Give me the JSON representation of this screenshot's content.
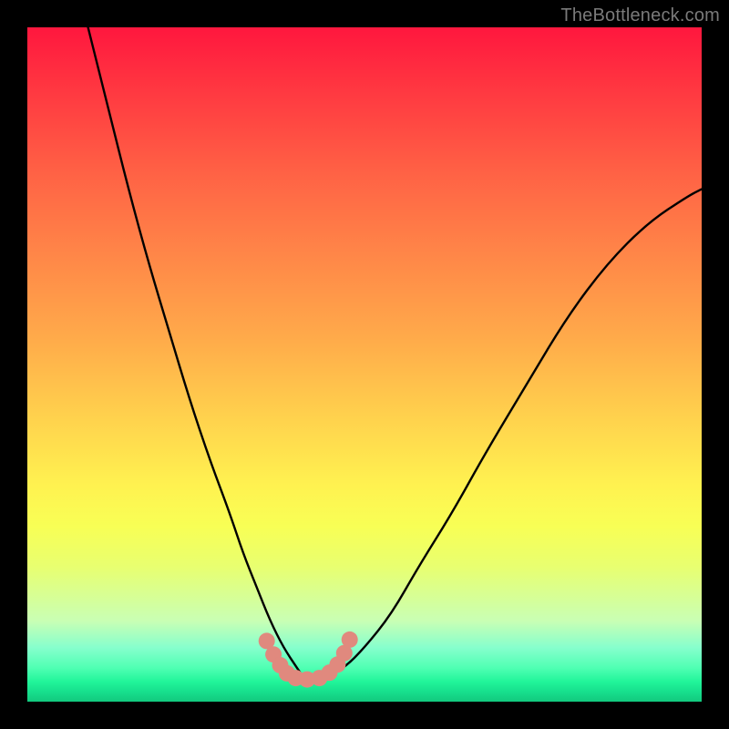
{
  "watermark": "TheBottleneck.com",
  "chart_data": {
    "type": "line",
    "title": "",
    "xlabel": "",
    "ylabel": "",
    "xlim": [
      0,
      100
    ],
    "ylim": [
      0,
      100
    ],
    "note": "Axes have no visible tick labels; values are normalized 0–100 on each axis. y=0 is the bottom (green) edge. Main black curve is a V-shape; salmon dotted curve highlights the trough.",
    "series": [
      {
        "name": "main-curve",
        "color": "#000000",
        "style": "solid",
        "x": [
          9,
          12,
          15,
          18,
          21,
          24,
          27,
          30,
          32,
          34,
          36,
          38,
          40,
          41,
          42,
          44,
          47,
          50,
          54,
          58,
          63,
          68,
          74,
          80,
          86,
          92,
          98,
          100
        ],
        "y": [
          100,
          88,
          76,
          65,
          55,
          45,
          36,
          28,
          22,
          17,
          12,
          8,
          5,
          3.5,
          3.3,
          3.5,
          5,
          8,
          13,
          20,
          28,
          37,
          47,
          57,
          65,
          71,
          75,
          76
        ]
      },
      {
        "name": "trough-dots",
        "color": "#e0897e",
        "style": "dots",
        "x": [
          35.5,
          36.5,
          37.5,
          38.5,
          39.8,
          41.5,
          43.3,
          44.8,
          46.0,
          47.0,
          47.8
        ],
        "y": [
          9.0,
          7.0,
          5.4,
          4.2,
          3.5,
          3.3,
          3.5,
          4.3,
          5.5,
          7.2,
          9.2
        ]
      }
    ],
    "background_gradient": {
      "top": "#ff173e",
      "mid": "#fff250",
      "bottom": "#12c97e"
    }
  }
}
